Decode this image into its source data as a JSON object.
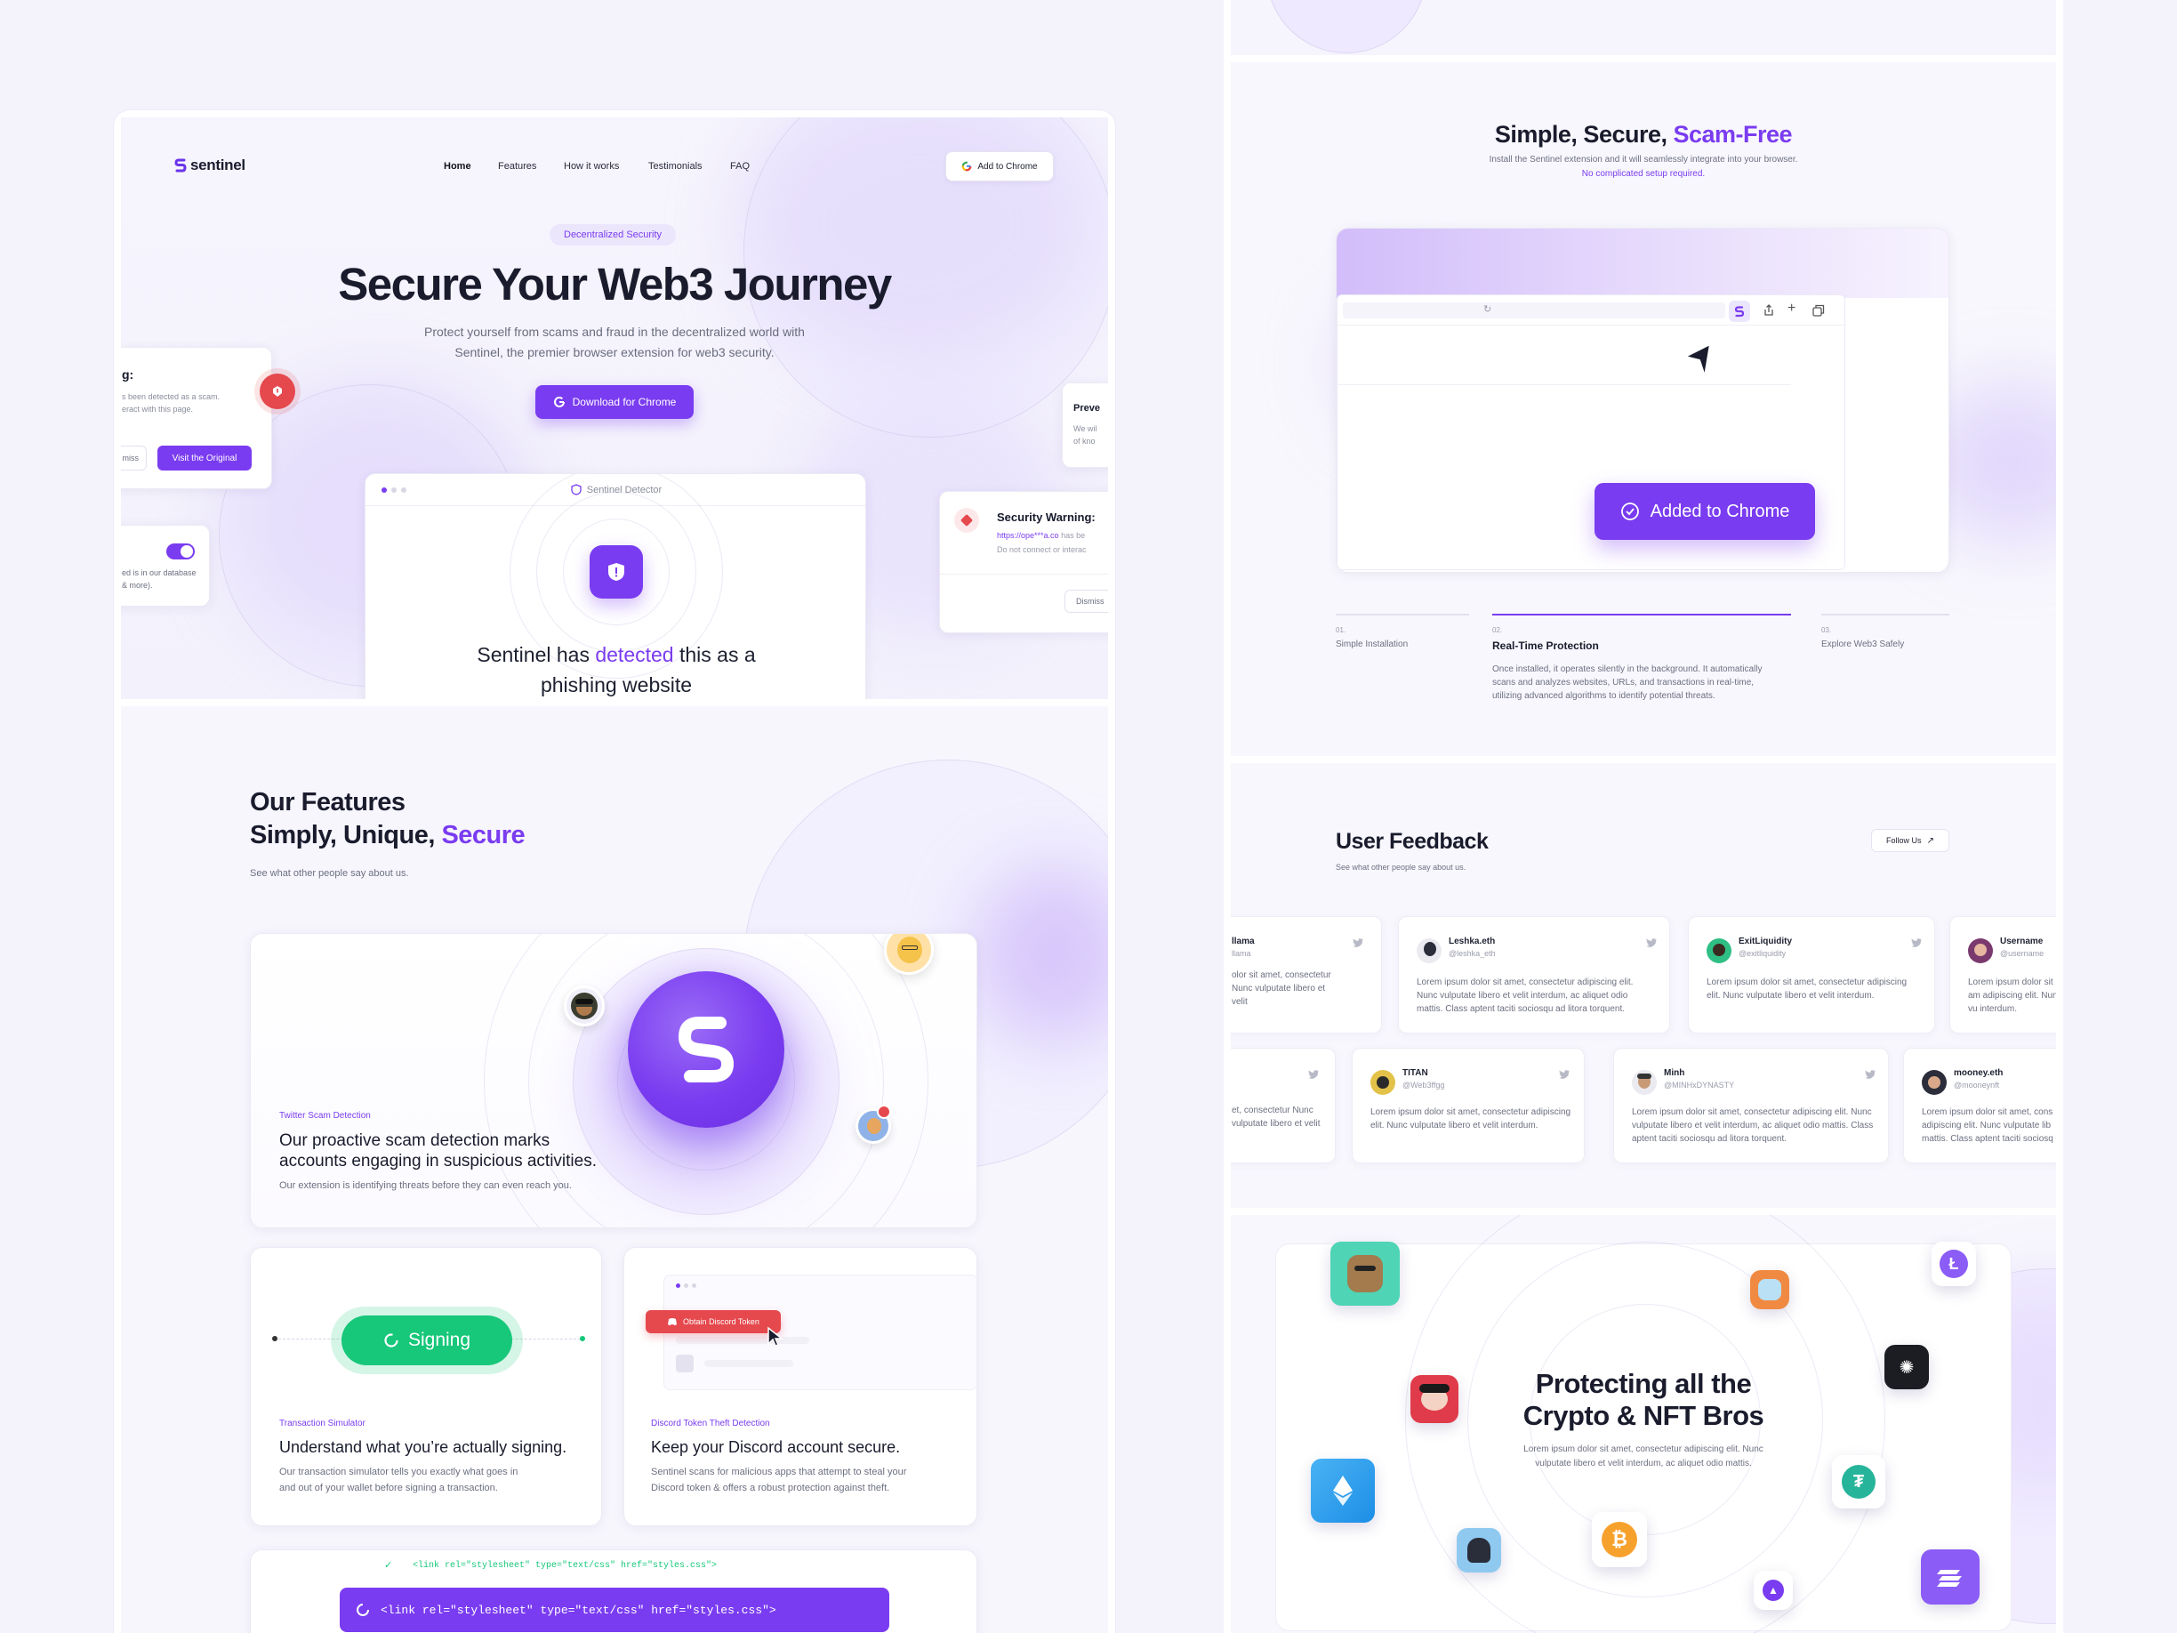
{
  "left_top": {
    "logo_text": "sentinel",
    "nav": [
      "Home",
      "Features",
      "How it works",
      "Testimonials",
      "FAQ"
    ],
    "add_to_chrome": "Add to Chrome",
    "badge": "Decentralized Security",
    "headline": "Secure Your Web3 Journey",
    "sub_line1": "Protect yourself from scams and fraud in the decentralized world with",
    "sub_line2": "Sentinel, the premier browser extension for web3 security.",
    "download_btn": "Download for Chrome",
    "left_card": {
      "title": "g:",
      "line1": "s been detected as a scam.",
      "line2": "eract with this page.",
      "dismiss": "miss",
      "visit": "Visit the Original"
    },
    "toggle_card": {
      "line1": "ed is in our database",
      "line2": "& more)."
    },
    "right_small_card": {
      "title": "Preve",
      "line1": "We wil",
      "line2": "of kno"
    },
    "warning_card": {
      "title": "Security Warning:",
      "url": "https://ope***a.co",
      "url_tail": " has be",
      "line2": "Do not connect or interac",
      "dismiss": "Dismiss"
    },
    "detector": {
      "title": "Sentinel Detector",
      "msg_pre": "Sentinel has ",
      "msg_highlight": "detected",
      "msg_post": " this as a",
      "msg_line2": "phishing website"
    }
  },
  "left_bottom": {
    "title_line1": "Our Features",
    "title_line2_pre": "Simply, Unique, ",
    "title_line2_highlight": "Secure",
    "subtitle": "See what other people say about us.",
    "feature_main": {
      "tag": "Twitter Scam Detection",
      "title_line1": "Our proactive scam detection marks",
      "title_line2": "accounts engaging in suspicious activities.",
      "desc": "Our extension is identifying threats before they can even reach you."
    },
    "feature_tx": {
      "signing": "Signing",
      "tag": "Transaction Simulator",
      "title": "Understand what you’re actually signing.",
      "desc1": "Our transaction simulator tells you exactly what goes in",
      "desc2": "and out of your wallet before signing a transaction."
    },
    "feature_discord": {
      "obtain": "Obtain Discord Token",
      "tag": "Discord Token Theft Detection",
      "title": "Keep your Discord account secure.",
      "desc1": "Sentinel scans for malicious apps that attempt to steal your",
      "desc2": "Discord token & offers a robust protection against theft."
    },
    "code_line_small": "<link rel=\"stylesheet\" type=\"text/css\" href=\"styles.css\">",
    "code_line_bar": "<link rel=\"stylesheet\" type=\"text/css\" href=\"styles.css\">"
  },
  "right_how": {
    "title_pre": "Simple, Secure, ",
    "title_highlight": "Scam-Free",
    "sub1": "Install the Sentinel extension and it will seamlessly integrate into your browser.",
    "sub2": "No complicated setup required.",
    "added_btn": "Added to Chrome",
    "steps": [
      {
        "num": "01.",
        "label": "Simple Installation"
      },
      {
        "num": "02.",
        "label": "Real-Time Protection",
        "desc1": "Once installed, it operates silently in the background. It automatically",
        "desc2": "scans and analyzes websites, URLs, and transactions in real-time,",
        "desc3": "utilizing advanced algorithms to identify potential threats."
      },
      {
        "num": "03.",
        "label": "Explore Web3 Safely"
      }
    ],
    "active_step_progress": 1.0
  },
  "right_feedback": {
    "title": "User Feedback",
    "subtitle": "See what other people say about us.",
    "follow": "Follow Us",
    "lorem1": "Lorem ipsum dolor sit amet, consectetur adipiscing elit. Nunc vulputate libero et velit interdum, ac aliquet odio mattis. Class aptent taciti sociosqu ad litora torquent.",
    "row1": [
      {
        "name": "llama",
        "handle": "llama",
        "text": "olor sit amet, consectetur Nunc vulputate libero et velit"
      },
      {
        "name": "Leshka.eth",
        "handle": "@leshka_eth",
        "text": "Lorem ipsum dolor sit amet, consectetur adipiscing elit. Nunc vulputate libero et velit interdum, ac aliquet odio mattis. Class aptent taciti sociosqu ad litora torquent."
      },
      {
        "name": "ExitLiquidity",
        "handle": "@exitliquidity",
        "text": "Lorem ipsum dolor sit amet, consectetur adipiscing elit. Nunc vulputate libero et velit interdum."
      },
      {
        "name": "Username",
        "handle": "@username",
        "text": "Lorem ipsum dolor sit am adipiscing elit. Nunc vu interdum."
      }
    ],
    "row2": [
      {
        "name": "",
        "handle": "",
        "text": "et, consectetur Nunc vulputate libero et velit"
      },
      {
        "name": "TITAN",
        "handle": "@Web3ffgg",
        "text": "Lorem ipsum dolor sit amet, consectetur adipiscing elit. Nunc vulputate libero et velit interdum."
      },
      {
        "name": "Minh",
        "handle": "@MINHxDYNASTY",
        "text": "Lorem ipsum dolor sit amet, consectetur adipiscing elit. Nunc vulputate libero et velit interdum, ac aliquet odio mattis. Class aptent taciti sociosqu ad litora torquent."
      },
      {
        "name": "mooney.eth",
        "handle": "@mooneynft",
        "text": "Lorem ipsum dolor sit amet, cons adipiscing elit. Nunc vulputate lib mattis. Class aptent taciti sociosq"
      }
    ]
  },
  "right_nft": {
    "title_line1": "Protecting all the",
    "title_line2": "Crypto & NFT Bros",
    "desc1": "Lorem ipsum dolor sit amet, consectetur adipiscing elit. Nunc",
    "desc2": "vulputate libero et velit interdum, ac aliquet odio mattis."
  },
  "colors": {
    "accent": "#7a3cf0",
    "green": "#17c77a",
    "red": "#e5484d",
    "ink": "#171a2b"
  }
}
